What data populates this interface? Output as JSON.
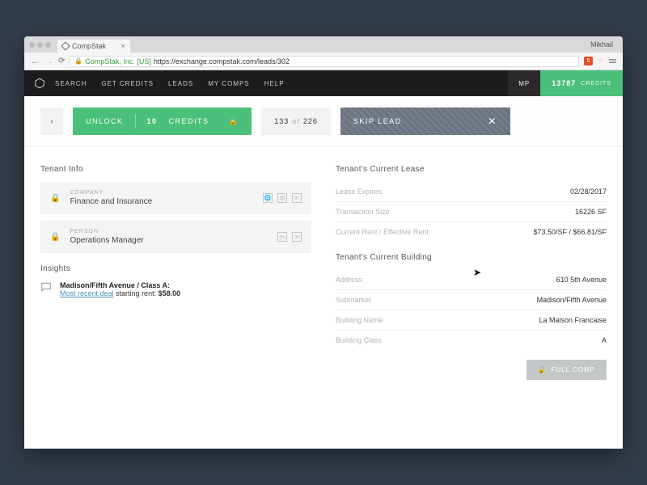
{
  "browser": {
    "tab_title": "CompStak",
    "user": "Mikhail",
    "cert_label": "CompStak, Inc. [US]",
    "url": "https://exchange.compstak.com/leads/302"
  },
  "header": {
    "nav": [
      "SEARCH",
      "GET CREDITS",
      "LEADS",
      "MY COMPS",
      "HELP"
    ],
    "initials": "MP",
    "credits_count": "13787",
    "credits_label": "CREDITS"
  },
  "toolbar": {
    "back_glyph": "‹",
    "unlock_label": "UNLOCK",
    "unlock_cost_n": "10",
    "unlock_cost_unit": "CREDITS",
    "counter_current": "133",
    "counter_of": "of",
    "counter_total": "226",
    "skip_label": "SKIP LEAD",
    "skip_close": "✕"
  },
  "tenant_info": {
    "title": "Tenant Info",
    "company_label": "COMPANY",
    "company_value": "Finance and Insurance",
    "person_label": "PERSON",
    "person_value": "Operations Manager"
  },
  "insights": {
    "title": "Insights",
    "heading": "Madison/Fifth Avenue / Class A:",
    "link_text": "Most recent deal",
    "tail_text": " starting rent: ",
    "tail_value": "$58.00"
  },
  "lease": {
    "title": "Tenant's Current Lease",
    "rows": [
      {
        "k": "Lease Expires",
        "v": "02/28/2017"
      },
      {
        "k": "Transaction Size",
        "v": "16226 SF"
      },
      {
        "k": "Current Rent / Effective Rent",
        "v": "$73.50/SF / $66.81/SF"
      }
    ]
  },
  "building": {
    "title": "Tenant's Current Building",
    "rows": [
      {
        "k": "Address",
        "v": "610 5th Avenue"
      },
      {
        "k": "Submarket",
        "v": "Madison/Fifth Avenue"
      },
      {
        "k": "Building Name",
        "v": "La Maison Francaise"
      },
      {
        "k": "Building Class",
        "v": "A"
      }
    ],
    "full_comp_label": "FULL COMP"
  }
}
